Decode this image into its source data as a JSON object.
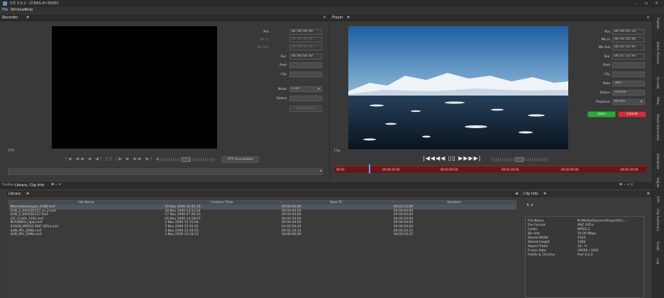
{
  "window": {
    "title": "ICE 3.0.2 - LT-BAS-IH-S50EV",
    "controls": "– ▫ ×"
  },
  "menu": [
    "File",
    "Windows",
    "Help"
  ],
  "recorder": {
    "title": "Recorder",
    "fields": [
      {
        "label": "Pos",
        "value": "00:00:00:00"
      },
      {
        "label": "Mk In",
        "value": "00:00:00:00"
      },
      {
        "label": "Mk Out",
        "value": "00:00:00:00"
      },
      {
        "label": "Dur",
        "value": "00:00:00:00"
      },
      {
        "label": "Reel",
        "value": ""
      },
      {
        "label": "Clip",
        "value": ""
      },
      {
        "label": "Mode",
        "value": "Link"
      },
      {
        "label": "Status",
        "value": ""
      }
    ],
    "start_button": "Start Record",
    "vtr_label": "VTR",
    "vtr_status": "VTR Unavailable"
  },
  "player": {
    "title": "Player",
    "fields": [
      {
        "label": "Pos",
        "value": "00:00:04:28"
      },
      {
        "label": "Mk In",
        "value": "00:00:00:00"
      },
      {
        "label": "Mk Out",
        "value": "00:02:16:09"
      },
      {
        "label": "Dur",
        "value": "00:02:16:09"
      },
      {
        "label": "Reel",
        "value": ""
      },
      {
        "label": "Clip",
        "value": ""
      },
      {
        "label": "Rate",
        "value": "30FP"
      },
      {
        "label": "Status",
        "value": "Paused"
      },
      {
        "label": "Playback",
        "value": "Normal"
      }
    ],
    "save_button": "Save",
    "cancel_button": "Cancel",
    "clip_label": "Clip",
    "timeline_marks": [
      "00:00",
      "00:00:30:00",
      "00:01:00:00",
      "00:01:30:00",
      "00:02:00:00",
      "00:02:30:00"
    ]
  },
  "tabs": [
    "Toolbox",
    "Library, Clip Info"
  ],
  "library": {
    "title": "Library",
    "columns": [
      "File Name",
      "Creation Time",
      "Start TC",
      "Duration"
    ],
    "rows": [
      [
        "Monroeleorangue_1080.mxf",
        "30 Nov 2009 16:45:35",
        "00:00:00;00",
        "00:02:16;09"
      ],
      [
        "SUN_2_0950Z0157_jn_2.mxf",
        "30 Nov 2009 14:23:24",
        "00:00:00;24",
        "00:00:00;00"
      ],
      [
        "SUN_2_0950Z0157.mxf",
        "17 Nov 2009 07:26:20",
        "00:00:00;00",
        "00:00:00;00"
      ],
      [
        "ICE_Credit_1042.mxf",
        "16 Nov 2009 14:58:07",
        "00:00:30;00",
        "00:00:10;00"
      ],
      [
        "McFaBB0a_rgsp.mxf",
        "3 Nov 2009 15:35:04",
        "00:00:00;00",
        "00:00:04;00"
      ],
      [
        "02SUN_MPEG2 MXF OP1a.mxf",
        "3 Nov 2009 15:35:01",
        "01:02:00;00",
        "00:00:04;00"
      ],
      [
        "SUN_IPH_30Mb.mxf",
        "3 Nov 2009 15:34:55",
        "00:01:10;14",
        "00:00:10;15"
      ],
      [
        "SUN_IPH_30Mb.mxf",
        "3 Nov 2009 15:34:52",
        "00:00:00;00",
        "00:00:10;15"
      ]
    ]
  },
  "clip_info": {
    "title": "Clip Info",
    "rows": [
      [
        "File Name",
        "N:\\Media\\Sources\\Project\\Fro..."
      ],
      [
        "File Format",
        "MXF OP1a"
      ],
      [
        "Codec",
        "MPEG-2"
      ],
      [
        "Bit-rate",
        "50.00 Mbps"
      ],
      [
        "Stored Width",
        "1920"
      ],
      [
        "Stored Height",
        "1080"
      ],
      [
        "Aspect Ratio",
        "16 : 9"
      ],
      [
        "Frame Rate",
        "30000 / 1001"
      ],
      [
        "Profile & Chroma",
        "Prof 4:2:2"
      ]
    ]
  },
  "side_tabs": [
    "Publish",
    "Batch Process",
    "Encode",
    "Filter",
    "Movie Generator",
    "Distribute",
    "Adjust",
    "VTR",
    "Clip Summary",
    "Script",
    "Log"
  ]
}
